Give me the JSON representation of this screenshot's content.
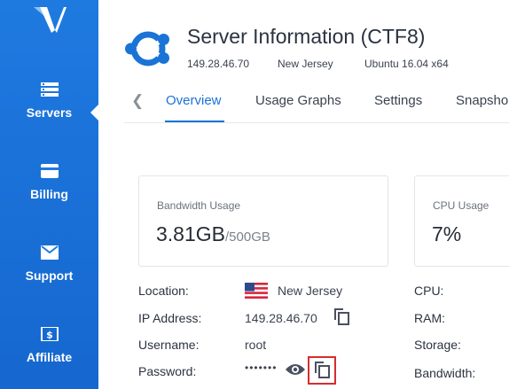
{
  "sidebar": {
    "logo_icon": "vultr-logo",
    "items": [
      {
        "label": "Servers",
        "icon": "servers-list-icon",
        "active": true
      },
      {
        "label": "Billing",
        "icon": "credit-card-icon",
        "active": false
      },
      {
        "label": "Support",
        "icon": "envelope-icon",
        "active": false
      },
      {
        "label": "Affiliate",
        "icon": "dollar-icon",
        "active": false
      }
    ]
  },
  "header": {
    "os_icon": "ubuntu-logo-icon",
    "title": "Server Information (CTF8)",
    "ip": "149.28.46.70",
    "location": "New Jersey",
    "os": "Ubuntu 16.04 x64"
  },
  "tabs": {
    "items": [
      "Overview",
      "Usage Graphs",
      "Settings",
      "Snapsho"
    ],
    "active": "Overview"
  },
  "cards": [
    {
      "title": "Bandwidth Usage",
      "value": "3.81GB",
      "suffix": "/500GB"
    },
    {
      "title": "CPU Usage",
      "value": "7%"
    }
  ],
  "details_left": [
    {
      "label": "Location:",
      "value": "New Jersey",
      "icon": "us-flag-icon"
    },
    {
      "label": "IP Address:",
      "value": "149.28.46.70"
    },
    {
      "label": "Username:",
      "value": "root"
    },
    {
      "label": "Password:",
      "value": "•••••••"
    }
  ],
  "details_right": [
    {
      "label": "CPU:"
    },
    {
      "label": "RAM:"
    },
    {
      "label": "Storage:"
    },
    {
      "label": "Bandwidth:"
    }
  ],
  "colors": {
    "sidebar": "#1f7ae0",
    "accent": "#1a73d6",
    "ubuntu": "#1a73d6",
    "highlight": "#d62d2d"
  }
}
